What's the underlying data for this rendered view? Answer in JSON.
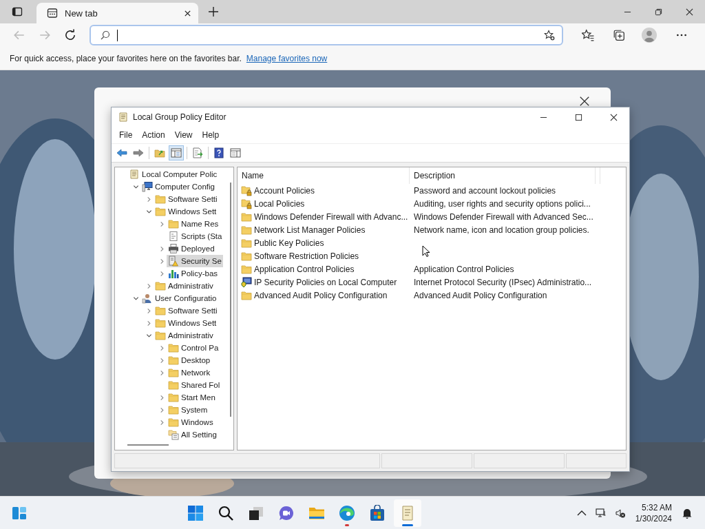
{
  "browser": {
    "tab": {
      "title": "New tab",
      "selected": true
    },
    "favorites_bar": {
      "message": "For quick access, place your favorites here on the favorites bar.",
      "link": "Manage favorites now"
    }
  },
  "window": {
    "title": "Local Group Policy Editor",
    "menu": [
      "File",
      "Action",
      "View",
      "Help"
    ],
    "toolbar": [
      {
        "kind": "back",
        "selected": false
      },
      {
        "kind": "forward",
        "selected": false
      },
      {
        "kind": "up",
        "selected": false
      },
      {
        "kind": "tree",
        "selected": true
      },
      {
        "kind": "export",
        "selected": false
      },
      {
        "kind": "help",
        "selected": false
      },
      {
        "kind": "pane",
        "selected": false
      }
    ],
    "tree": [
      {
        "label": "Local Computer Polic",
        "kind": "policy",
        "selected": false,
        "children": [
          {
            "label": "Computer Config",
            "kind": "computer",
            "expanded": true,
            "selected": false,
            "children": [
              {
                "label": "Software Setti",
                "kind": "folder",
                "expanded": false,
                "selected": false
              },
              {
                "label": "Windows Sett",
                "kind": "folder",
                "expanded": true,
                "selected": false,
                "children": [
                  {
                    "label": "Name Res",
                    "kind": "folder",
                    "expanded": false,
                    "selected": false
                  },
                  {
                    "label": "Scripts (Sta",
                    "kind": "script",
                    "selected": false
                  },
                  {
                    "label": "Deployed",
                    "kind": "printer",
                    "expanded": false,
                    "selected": false
                  },
                  {
                    "label": "Security Se",
                    "kind": "security",
                    "expanded": false,
                    "selected": true
                  },
                  {
                    "label": "Policy-bas",
                    "kind": "chart",
                    "expanded": false,
                    "selected": false
                  }
                ]
              },
              {
                "label": "Administrativ",
                "kind": "folder",
                "expanded": false,
                "selected": false
              }
            ]
          },
          {
            "label": "User Configuratio",
            "kind": "user",
            "expanded": true,
            "selected": false,
            "children": [
              {
                "label": "Software Setti",
                "kind": "folder",
                "expanded": false,
                "selected": false
              },
              {
                "label": "Windows Sett",
                "kind": "folder",
                "expanded": false,
                "selected": false
              },
              {
                "label": "Administrativ",
                "kind": "folder",
                "expanded": true,
                "selected": false,
                "children": [
                  {
                    "label": "Control Pa",
                    "kind": "folder",
                    "expanded": false,
                    "selected": false
                  },
                  {
                    "label": "Desktop",
                    "kind": "folder",
                    "expanded": false,
                    "selected": false
                  },
                  {
                    "label": "Network",
                    "kind": "folder",
                    "expanded": false,
                    "selected": false
                  },
                  {
                    "label": "Shared Fol",
                    "kind": "folder",
                    "selected": false
                  },
                  {
                    "label": "Start Men",
                    "kind": "folder",
                    "expanded": false,
                    "selected": false
                  },
                  {
                    "label": "System",
                    "kind": "folder",
                    "expanded": false,
                    "selected": false
                  },
                  {
                    "label": "Windows",
                    "kind": "folder",
                    "expanded": false,
                    "selected": false
                  },
                  {
                    "label": "All Setting",
                    "kind": "allsettings",
                    "selected": false
                  }
                ]
              }
            ]
          }
        ]
      }
    ],
    "list": {
      "columns": [
        "Name",
        "Description"
      ],
      "rows": [
        {
          "name": "Account Policies",
          "description": "Password and account lockout policies",
          "kind": "locked-folder"
        },
        {
          "name": "Local Policies",
          "description": "Auditing, user rights and security options polici...",
          "kind": "locked-folder"
        },
        {
          "name": "Windows Defender Firewall with Advanc...",
          "description": "Windows Defender Firewall with Advanced Sec...",
          "kind": "folder"
        },
        {
          "name": "Network List Manager Policies",
          "description": "Network name, icon and location group policies.",
          "kind": "folder"
        },
        {
          "name": "Public Key Policies",
          "kind": "folder"
        },
        {
          "name": "Software Restriction Policies",
          "kind": "folder"
        },
        {
          "name": "Application Control Policies",
          "description": "Application Control Policies",
          "kind": "folder"
        },
        {
          "name": "IP Security Policies on Local Computer",
          "description": "Internet Protocol Security (IPsec) Administratio...",
          "kind": "ipsec"
        },
        {
          "name": "Advanced Audit Policy Configuration",
          "description": "Advanced Audit Policy Configuration",
          "kind": "folder"
        }
      ]
    }
  },
  "taskbar": {
    "apps": [
      {
        "kind": "start",
        "running": false,
        "focused": false
      },
      {
        "kind": "search",
        "running": false,
        "focused": false
      },
      {
        "kind": "task-view",
        "running": false,
        "focused": false
      },
      {
        "kind": "chat",
        "running": false,
        "focused": false
      },
      {
        "kind": "explorer",
        "running": false,
        "focused": false
      },
      {
        "kind": "edge",
        "running": true,
        "focused": false
      },
      {
        "kind": "store",
        "running": false,
        "focused": false
      },
      {
        "kind": "policy",
        "running": true,
        "focused": true
      }
    ],
    "time": "5:32 AM",
    "date": "1/30/2024"
  }
}
